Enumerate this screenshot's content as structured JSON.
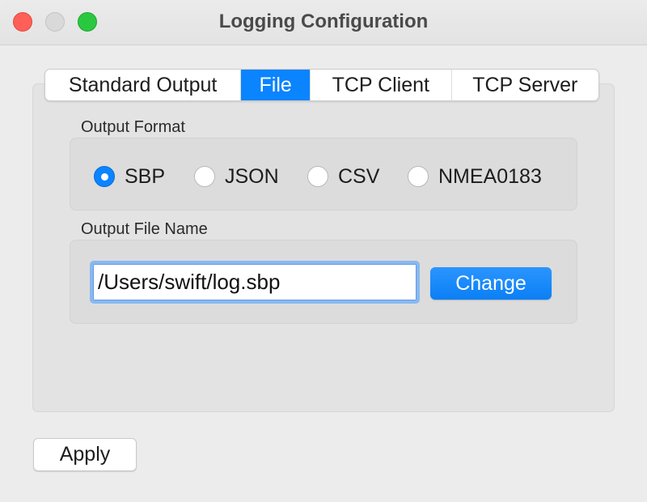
{
  "window": {
    "title": "Logging Configuration",
    "traffic_lights": [
      "close",
      "minimize",
      "zoom"
    ]
  },
  "tabs": [
    {
      "label": "Standard Output",
      "active": false
    },
    {
      "label": "File",
      "active": true
    },
    {
      "label": "TCP Client",
      "active": false
    },
    {
      "label": "TCP Server",
      "active": false
    }
  ],
  "output_format": {
    "label": "Output Format",
    "options": [
      {
        "label": "SBP",
        "selected": true
      },
      {
        "label": "JSON",
        "selected": false
      },
      {
        "label": "CSV",
        "selected": false
      },
      {
        "label": "NMEA0183",
        "selected": false
      }
    ]
  },
  "output_file": {
    "label": "Output File Name",
    "value": "/Users/swift/log.sbp",
    "change_label": "Change"
  },
  "footer": {
    "apply_label": "Apply"
  },
  "colors": {
    "accent": "#0a84ff",
    "close": "#fe5f57",
    "minimize": "#d9d9d9",
    "zoom": "#2ac840"
  }
}
